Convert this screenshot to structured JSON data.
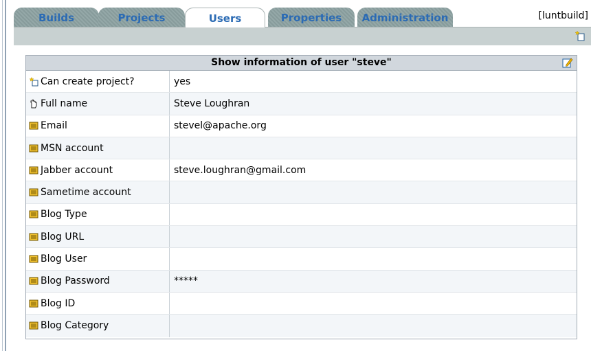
{
  "tabs": [
    {
      "label": "Builds"
    },
    {
      "label": "Projects"
    },
    {
      "label": "Users"
    },
    {
      "label": "Properties"
    },
    {
      "label": "Administration"
    }
  ],
  "current_user": "[luntbuild]",
  "panel": {
    "title": "Show information of user \"steve\"",
    "rows": [
      {
        "icon": "new-item-icon",
        "label": "Can create project?",
        "value": "yes"
      },
      {
        "icon": "hand-icon",
        "label": "Full name",
        "value": "Steve Loughran"
      },
      {
        "icon": "field-icon",
        "label": "Email",
        "value": "stevel@apache.org"
      },
      {
        "icon": "field-icon",
        "label": "MSN account",
        "value": ""
      },
      {
        "icon": "field-icon",
        "label": "Jabber account",
        "value": "steve.loughran@gmail.com"
      },
      {
        "icon": "field-icon",
        "label": "Sametime account",
        "value": ""
      },
      {
        "icon": "field-icon",
        "label": "Blog Type",
        "value": ""
      },
      {
        "icon": "field-icon",
        "label": "Blog URL",
        "value": ""
      },
      {
        "icon": "field-icon",
        "label": "Blog User",
        "value": ""
      },
      {
        "icon": "field-icon",
        "label": "Blog Password",
        "value": "*****"
      },
      {
        "icon": "field-icon",
        "label": "Blog ID",
        "value": ""
      },
      {
        "icon": "field-icon",
        "label": "Blog Category",
        "value": ""
      }
    ]
  },
  "colors": {
    "tab_text": "#2b6bb4",
    "tab_bg": "#8ea3a3",
    "toolbar_bg": "#c8d1d1",
    "panel_header_bg": "#d1d7dd"
  }
}
